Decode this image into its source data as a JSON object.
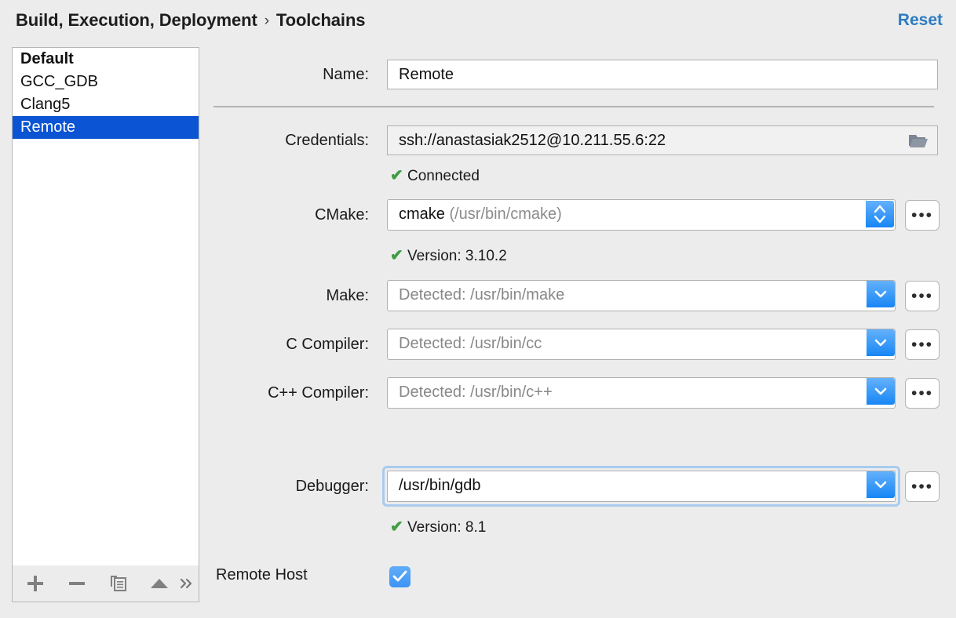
{
  "header": {
    "breadcrumb_parent": "Build, Execution, Deployment",
    "breadcrumb_separator": "›",
    "breadcrumb_current": "Toolchains",
    "reset_label": "Reset",
    "reset_color": "#2d7cc2"
  },
  "sidebar": {
    "items": [
      {
        "label": "Default",
        "bold": true,
        "selected": false
      },
      {
        "label": "GCC_GDB",
        "bold": false,
        "selected": false
      },
      {
        "label": "Clang5",
        "bold": false,
        "selected": false
      },
      {
        "label": "Remote",
        "bold": false,
        "selected": true
      }
    ],
    "selection_color": "#0b54d3",
    "toolbar": {
      "add": "add-icon",
      "remove": "remove-icon",
      "copy": "copy-icon",
      "move_up": "arrow-up-icon",
      "more": "»"
    }
  },
  "form": {
    "name": {
      "label": "Name:",
      "value": "Remote"
    },
    "credentials": {
      "label": "Credentials:",
      "value": "ssh://anastasiak2512@10.211.55.6:22",
      "browse_icon": "folder-icon",
      "status": "Connected",
      "status_check": "✔",
      "status_color": "#3f9c42"
    },
    "cmake": {
      "label": "CMake:",
      "value_main": "cmake",
      "value_path": "(/usr/bin/cmake)",
      "status": "Version: 3.10.2",
      "status_check": "✔",
      "ellipsis_label": "•••"
    },
    "make": {
      "label": "Make:",
      "placeholder": "Detected: /usr/bin/make",
      "ellipsis_label": "•••"
    },
    "c_compiler": {
      "label": "C Compiler:",
      "placeholder": "Detected: /usr/bin/cc",
      "ellipsis_label": "•••"
    },
    "cpp_compiler": {
      "label": "C++ Compiler:",
      "placeholder": "Detected: /usr/bin/c++",
      "ellipsis_label": "•••"
    },
    "debugger": {
      "label": "Debugger:",
      "value": "/usr/bin/gdb",
      "status": "Version: 8.1",
      "status_check": "✔",
      "ellipsis_label": "•••",
      "focused": true
    },
    "remote_host": {
      "label": "Remote Host",
      "checked": true,
      "checkbox_color": "#3d94f6"
    }
  }
}
